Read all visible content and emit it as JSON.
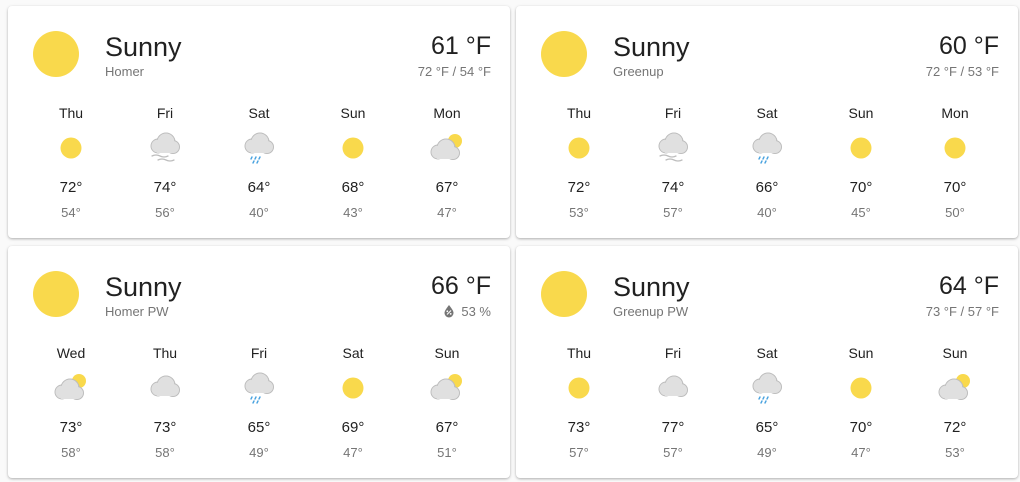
{
  "colors": {
    "sun": "#f9d94c",
    "cloud": "#e0e0e0",
    "cloud_outline": "#bdbdbd",
    "rain": "#4aa3df",
    "secondary_text": "#757575"
  },
  "cards": [
    {
      "condition": "Sunny",
      "condition_icon": "sun-icon",
      "name": "Homer",
      "temp": "61 °F",
      "sub": "72 °F / 54 °F",
      "sub_icon": null,
      "forecast": [
        {
          "day": "Thu",
          "icon": "sun",
          "hi": "72°",
          "lo": "54°"
        },
        {
          "day": "Fri",
          "icon": "cloudy-fog",
          "hi": "74°",
          "lo": "56°"
        },
        {
          "day": "Sat",
          "icon": "cloudy-rain",
          "hi": "64°",
          "lo": "40°"
        },
        {
          "day": "Sun",
          "icon": "sun",
          "hi": "68°",
          "lo": "43°"
        },
        {
          "day": "Mon",
          "icon": "partly-cloudy",
          "hi": "67°",
          "lo": "47°"
        }
      ]
    },
    {
      "condition": "Sunny",
      "condition_icon": "sun-icon",
      "name": "Greenup",
      "temp": "60 °F",
      "sub": "72 °F / 53 °F",
      "sub_icon": null,
      "forecast": [
        {
          "day": "Thu",
          "icon": "sun",
          "hi": "72°",
          "lo": "53°"
        },
        {
          "day": "Fri",
          "icon": "cloudy-fog",
          "hi": "74°",
          "lo": "57°"
        },
        {
          "day": "Sat",
          "icon": "cloudy-rain",
          "hi": "66°",
          "lo": "40°"
        },
        {
          "day": "Sun",
          "icon": "sun",
          "hi": "70°",
          "lo": "45°"
        },
        {
          "day": "Mon",
          "icon": "sun",
          "hi": "70°",
          "lo": "50°"
        }
      ]
    },
    {
      "condition": "Sunny",
      "condition_icon": "sun-icon",
      "name": "Homer PW",
      "temp": "66 °F",
      "sub": "53 %",
      "sub_icon": "humidity-icon",
      "forecast": [
        {
          "day": "Wed",
          "icon": "partly-cloudy",
          "hi": "73°",
          "lo": "58°"
        },
        {
          "day": "Thu",
          "icon": "cloudy",
          "hi": "73°",
          "lo": "58°"
        },
        {
          "day": "Fri",
          "icon": "cloudy-rain",
          "hi": "65°",
          "lo": "49°"
        },
        {
          "day": "Sat",
          "icon": "sun",
          "hi": "69°",
          "lo": "47°"
        },
        {
          "day": "Sun",
          "icon": "partly-cloudy",
          "hi": "67°",
          "lo": "51°"
        }
      ]
    },
    {
      "condition": "Sunny",
      "condition_icon": "sun-icon",
      "name": "Greenup PW",
      "temp": "64 °F",
      "sub": "73 °F / 57 °F",
      "sub_icon": null,
      "forecast": [
        {
          "day": "Thu",
          "icon": "sun",
          "hi": "73°",
          "lo": "57°"
        },
        {
          "day": "Fri",
          "icon": "cloudy",
          "hi": "77°",
          "lo": "57°"
        },
        {
          "day": "Sat",
          "icon": "cloudy-rain",
          "hi": "65°",
          "lo": "49°"
        },
        {
          "day": "Sun",
          "icon": "sun",
          "hi": "70°",
          "lo": "47°"
        },
        {
          "day": "Sun",
          "icon": "partly-cloudy",
          "hi": "72°",
          "lo": "53°"
        }
      ]
    }
  ]
}
